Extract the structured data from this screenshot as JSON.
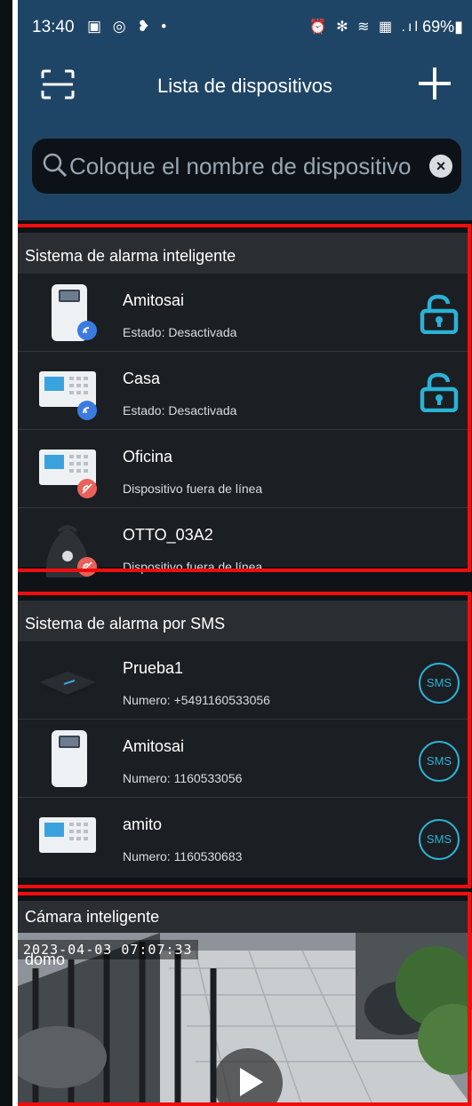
{
  "status_bar": {
    "time": "13:40",
    "left_icons": "▣ ◎ ❥ •",
    "right_icons": "⏰ ✻ ≋ ▦ .ıl",
    "battery": "69%▮"
  },
  "header": {
    "title": "Lista de dispositivos",
    "search_placeholder": "Coloque el nombre de dispositivo"
  },
  "sections": {
    "smart_alarm": {
      "title": "Sistema de alarma inteligente",
      "devices": [
        {
          "name": "Amitosai",
          "status": "Estado: Desactivada"
        },
        {
          "name": "Casa",
          "status": "Estado: Desactivada"
        },
        {
          "name": "Oficina",
          "status": "Dispositivo fuera de línea"
        },
        {
          "name": "OTTO_03A2",
          "status": "Dispositivo fuera de línea"
        }
      ]
    },
    "sms_alarm": {
      "title": "Sistema de alarma por SMS",
      "sms_label": "SMS",
      "devices": [
        {
          "name": "Prueba1",
          "number": "Numero: +5491160533056"
        },
        {
          "name": "Amitosai",
          "number": "Numero: 1160533056"
        },
        {
          "name": "amito",
          "number": "Numero: 1160530683"
        }
      ]
    },
    "camera": {
      "title": "Cámara inteligente",
      "camera_name": "domo",
      "timestamp": "2023-04-03  07:07:33"
    }
  },
  "colors": {
    "header_bg": "#1f4566",
    "accent": "#2ab3d6",
    "highlight_outline": "#f20d0d",
    "offline_badge": "#e8615a",
    "online_badge": "#3b7be0"
  }
}
